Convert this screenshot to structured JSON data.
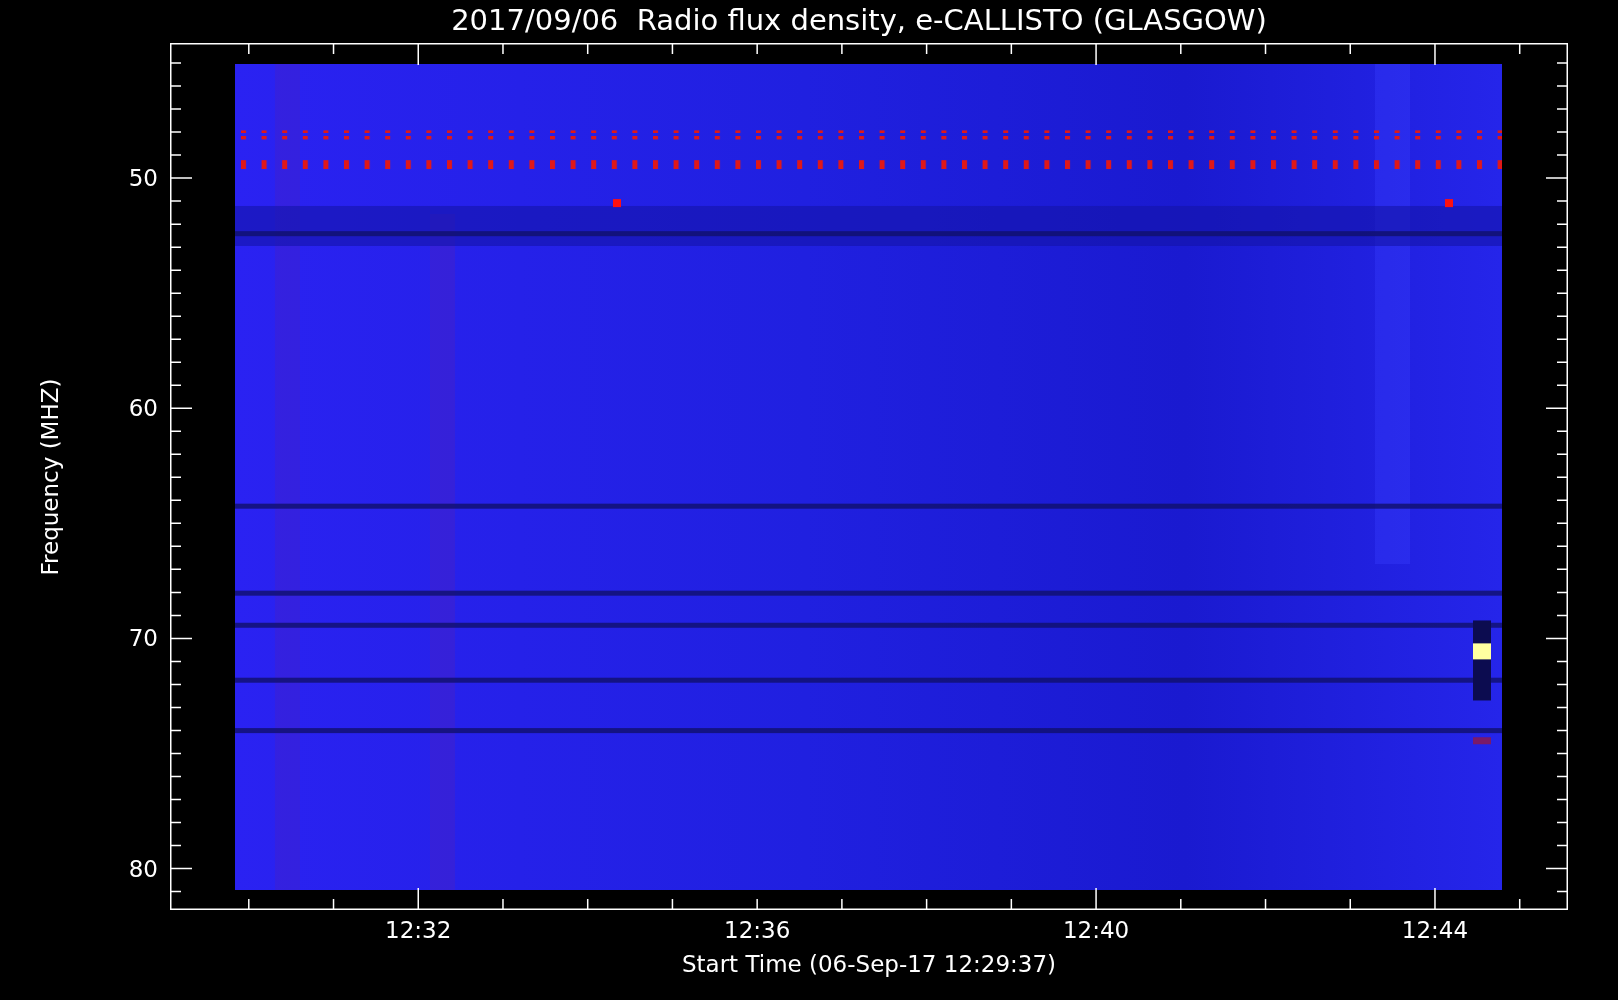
{
  "title": "2017/09/06  Radio flux density, e-CALLISTO (GLASGOW)",
  "y_axis": {
    "label": "Frequency (MHZ)",
    "ticks": [
      "50",
      "60",
      "70",
      "80"
    ]
  },
  "x_axis": {
    "label": "Start Time (06-Sep-17 12:29:37)",
    "ticks": [
      "12:32",
      "12:36",
      "12:40",
      "12:44"
    ]
  }
}
